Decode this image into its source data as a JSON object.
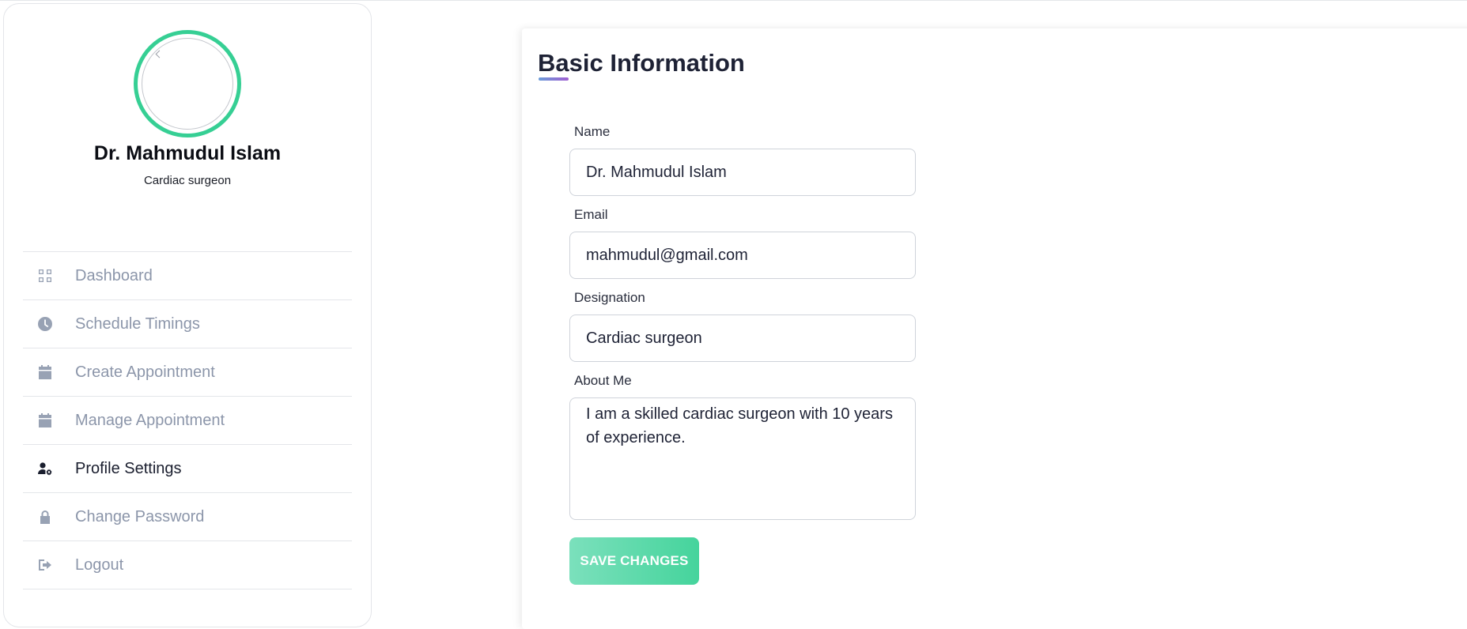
{
  "profile": {
    "name": "Dr. Mahmudul Islam",
    "designation": "Cardiac surgeon",
    "accent_color": "#36cf94"
  },
  "sidebar": {
    "items": [
      {
        "label": "Dashboard",
        "icon": "grid-icon",
        "active": false
      },
      {
        "label": "Schedule Timings",
        "icon": "clock-icon",
        "active": false
      },
      {
        "label": "Create Appointment",
        "icon": "calendar-icon",
        "active": false
      },
      {
        "label": "Manage Appointment",
        "icon": "calendar-icon",
        "active": false
      },
      {
        "label": "Profile Settings",
        "icon": "user-cog-icon",
        "active": true
      },
      {
        "label": "Change Password",
        "icon": "lock-icon",
        "active": false
      },
      {
        "label": "Logout",
        "icon": "logout-icon",
        "active": false
      }
    ]
  },
  "form": {
    "title": "Basic Information",
    "name_label": "Name",
    "name_value": "Dr. Mahmudul Islam",
    "email_label": "Email",
    "email_value": "mahmudul@gmail.com",
    "designation_label": "Designation",
    "designation_value": "Cardiac surgeon",
    "about_label": "About Me",
    "about_value": "I am a skilled cardiac surgeon with 10 years of experience.",
    "save_label": "SAVE CHANGES"
  }
}
